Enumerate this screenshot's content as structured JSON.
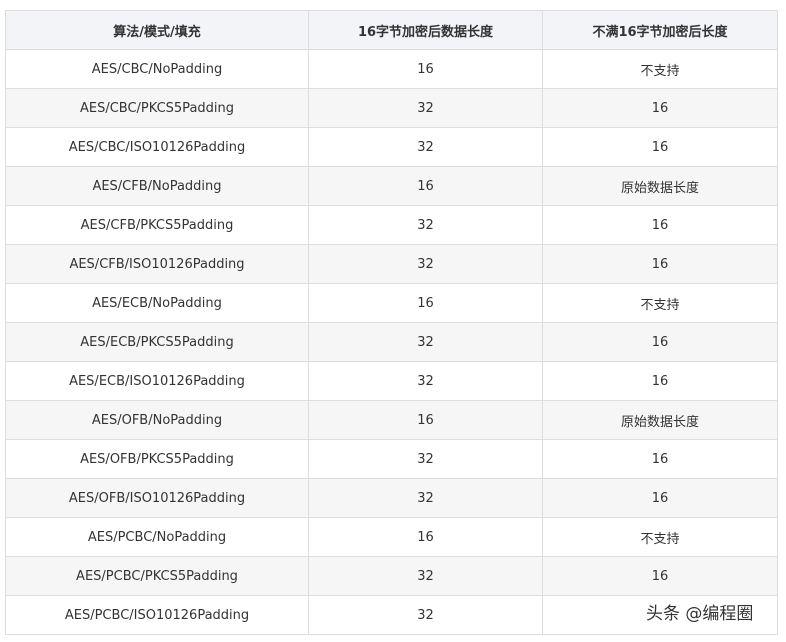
{
  "table": {
    "headers": [
      "算法/模式/填充",
      "16字节加密后数据长度",
      "不满16字节加密后长度"
    ],
    "rows": [
      [
        "AES/CBC/NoPadding",
        "16",
        "不支持"
      ],
      [
        "AES/CBC/PKCS5Padding",
        "32",
        "16"
      ],
      [
        "AES/CBC/ISO10126Padding",
        "32",
        "16"
      ],
      [
        "AES/CFB/NoPadding",
        "16",
        "原始数据长度"
      ],
      [
        "AES/CFB/PKCS5Padding",
        "32",
        "16"
      ],
      [
        "AES/CFB/ISO10126Padding",
        "32",
        "16"
      ],
      [
        "AES/ECB/NoPadding",
        "16",
        "不支持"
      ],
      [
        "AES/ECB/PKCS5Padding",
        "32",
        "16"
      ],
      [
        "AES/ECB/ISO10126Padding",
        "32",
        "16"
      ],
      [
        "AES/OFB/NoPadding",
        "16",
        "原始数据长度"
      ],
      [
        "AES/OFB/PKCS5Padding",
        "32",
        "16"
      ],
      [
        "AES/OFB/ISO10126Padding",
        "32",
        "16"
      ],
      [
        "AES/PCBC/NoPadding",
        "16",
        "不支持"
      ],
      [
        "AES/PCBC/PKCS5Padding",
        "32",
        "16"
      ],
      [
        "AES/PCBC/ISO10126Padding",
        "32",
        ""
      ]
    ]
  },
  "watermark": "头条 @编程圈"
}
